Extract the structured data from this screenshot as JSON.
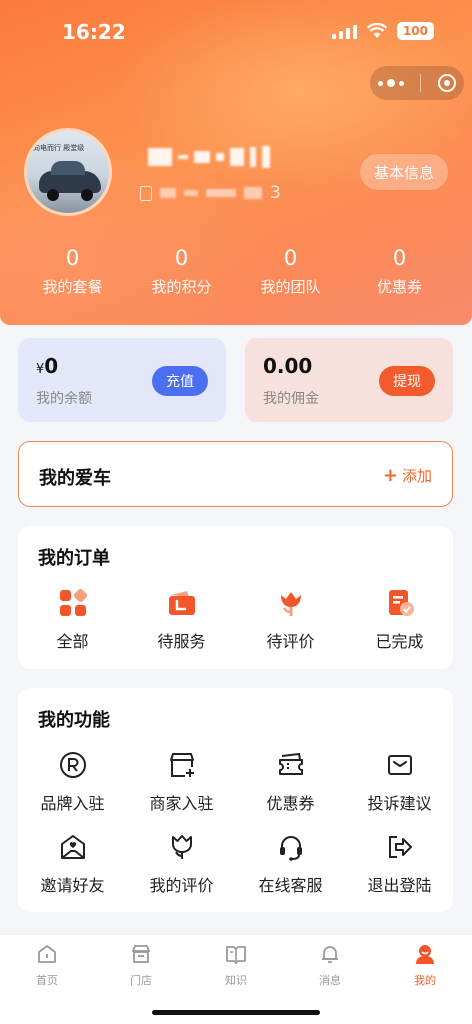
{
  "status_bar": {
    "time": "16:22",
    "battery": "100"
  },
  "profile": {
    "phone_suffix": "3",
    "basic_info_label": "基本信息",
    "avatar_text": "向电而行 殿堂级",
    "stats": [
      {
        "value": "0",
        "label": "我的套餐"
      },
      {
        "value": "0",
        "label": "我的积分"
      },
      {
        "value": "0",
        "label": "我的团队"
      },
      {
        "value": "0",
        "label": "优惠券"
      }
    ]
  },
  "wallet": {
    "balance": {
      "currency": "¥",
      "amount": "0",
      "label": "我的余额",
      "action": "充值"
    },
    "commission": {
      "amount": "0.00",
      "label": "我的佣金",
      "action": "提现"
    }
  },
  "my_car": {
    "title": "我的爱车",
    "add_label": "添加"
  },
  "orders": {
    "title": "我的订单",
    "items": [
      {
        "label": "全部",
        "icon": "grid-icon"
      },
      {
        "label": "待服务",
        "icon": "wallet-icon"
      },
      {
        "label": "待评价",
        "icon": "flower-icon"
      },
      {
        "label": "已完成",
        "icon": "completed-doc-icon"
      }
    ]
  },
  "functions": {
    "title": "我的功能",
    "items": [
      {
        "label": "品牌入驻",
        "icon": "registered-icon"
      },
      {
        "label": "商家入驻",
        "icon": "store-add-icon"
      },
      {
        "label": "优惠券",
        "icon": "ticket-icon"
      },
      {
        "label": "投诉建议",
        "icon": "mail-icon"
      },
      {
        "label": "邀请好友",
        "icon": "envelope-heart-icon"
      },
      {
        "label": "我的评价",
        "icon": "tulip-icon"
      },
      {
        "label": "在线客服",
        "icon": "headset-icon"
      },
      {
        "label": "退出登陆",
        "icon": "logout-icon"
      }
    ]
  },
  "tabbar": {
    "items": [
      {
        "label": "首页",
        "icon": "home-icon"
      },
      {
        "label": "门店",
        "icon": "store-icon"
      },
      {
        "label": "知识",
        "icon": "book-icon"
      },
      {
        "label": "消息",
        "icon": "bell-icon"
      },
      {
        "label": "我的",
        "icon": "person-icon",
        "active": true
      }
    ]
  },
  "colors": {
    "accent": "#f0682b",
    "hero": "#fb7a3c",
    "blue": "#4b6ff0"
  }
}
